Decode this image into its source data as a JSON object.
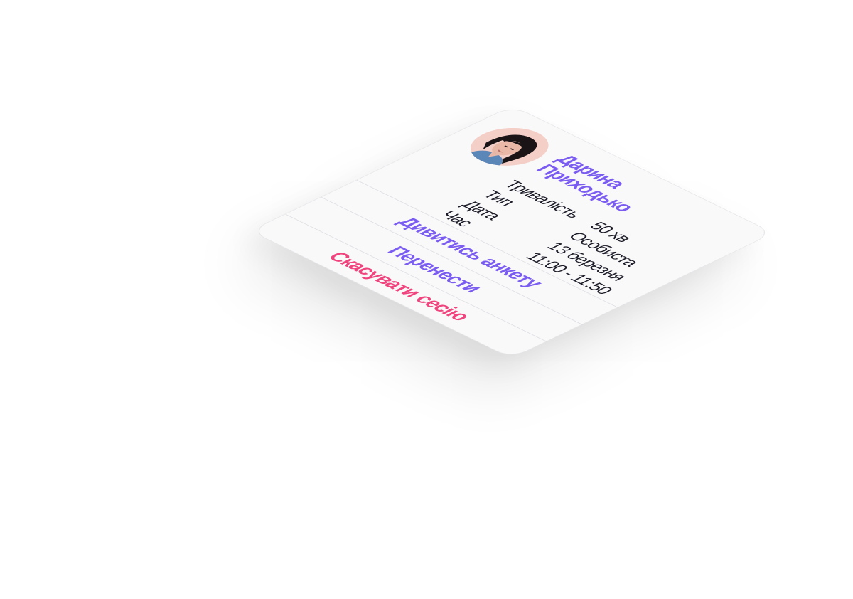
{
  "session_card": {
    "client_name_line1": "Дарина",
    "client_name_line2": "Приходько",
    "details": [
      {
        "label": "Тривалість",
        "value": "50 хв"
      },
      {
        "label": "Тип",
        "value": "Особиста"
      },
      {
        "label": "Дата",
        "value": "13 березня"
      },
      {
        "label": "Час",
        "value": "11:00 - 11:50"
      }
    ],
    "actions": {
      "view_profile": "Дивитись анкету",
      "reschedule": "Перенести",
      "cancel": "Скасувати сесію"
    }
  },
  "colors": {
    "accent": "#7b5cf0",
    "danger": "#f0447f",
    "text": "#1c1c28",
    "card_bg": "#f9f9fa"
  }
}
